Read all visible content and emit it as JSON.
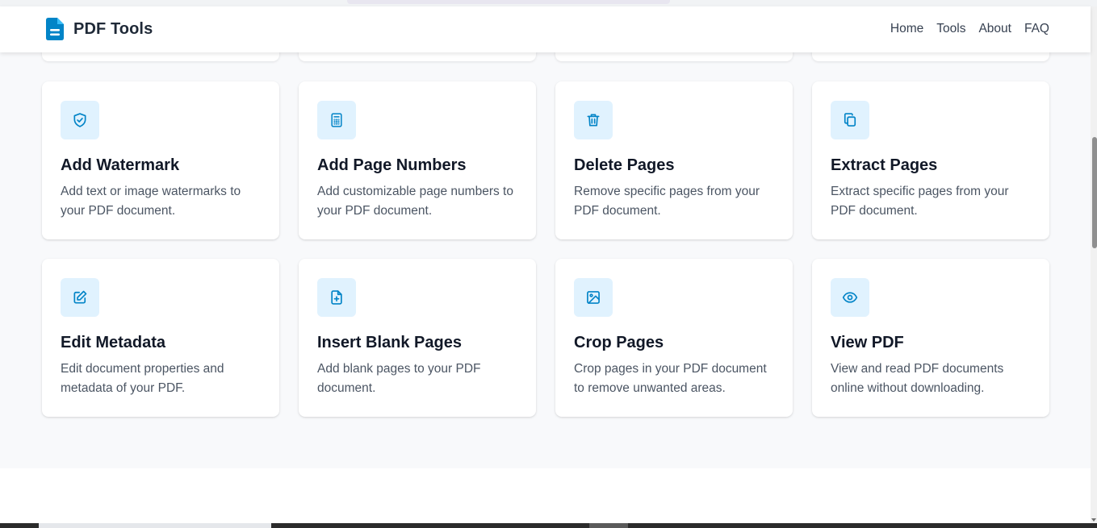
{
  "header": {
    "brand": "PDF Tools",
    "nav": [
      "Home",
      "Tools",
      "About",
      "FAQ"
    ]
  },
  "tools": [
    {
      "icon": "shield-check-icon",
      "title": "Add Watermark",
      "desc": "Add text or image watermarks to your PDF document."
    },
    {
      "icon": "calculator-icon",
      "title": "Add Page Numbers",
      "desc": "Add customizable page numbers to your PDF document."
    },
    {
      "icon": "trash-icon",
      "title": "Delete Pages",
      "desc": "Remove specific pages from your PDF document."
    },
    {
      "icon": "copy-icon",
      "title": "Extract Pages",
      "desc": "Extract specific pages from your PDF document."
    },
    {
      "icon": "edit-icon",
      "title": "Edit Metadata",
      "desc": "Edit document properties and metadata of your PDF."
    },
    {
      "icon": "file-plus-icon",
      "title": "Insert Blank Pages",
      "desc": "Add blank pages to your PDF document."
    },
    {
      "icon": "image-icon",
      "title": "Crop Pages",
      "desc": "Crop pages in your PDF document to remove unwanted areas."
    },
    {
      "icon": "eye-icon",
      "title": "View PDF",
      "desc": "View and read PDF documents online without downloading."
    }
  ],
  "colors": {
    "accent": "#0284c7",
    "icon_bg": "#e0f2fe",
    "page_bg": "#f8f9fb"
  }
}
